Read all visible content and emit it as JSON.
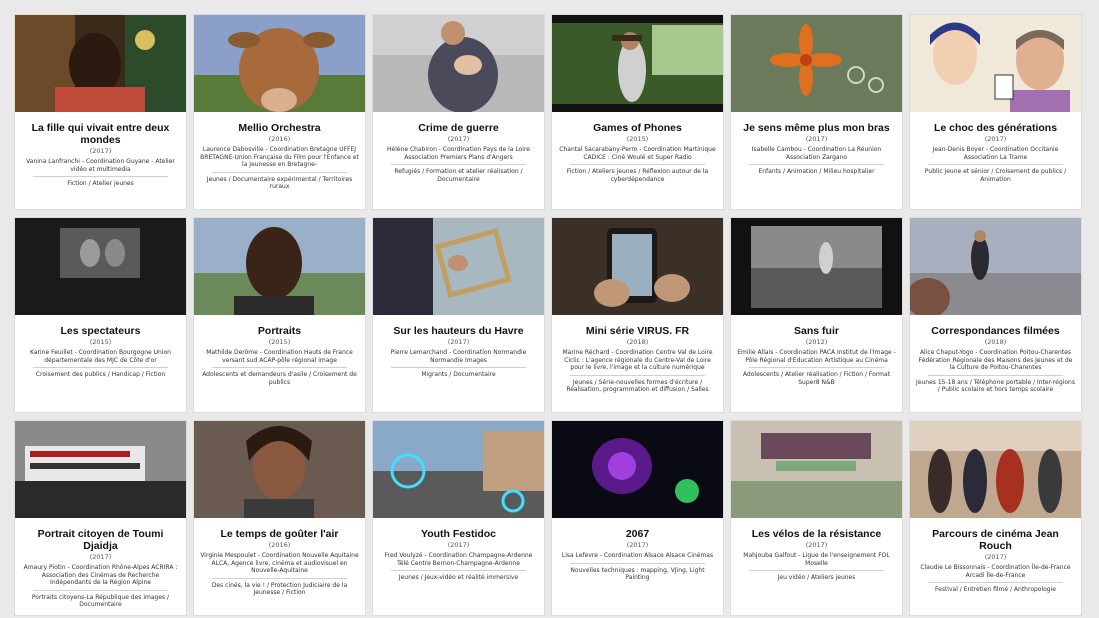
{
  "cards": [
    {
      "title": "La fille qui vivait entre deux mondes",
      "year": "(2017)",
      "credits": "Vanina Lanfranchi - Coordination Guyane - Atelier vidéo et multimedia",
      "tags": "Fiction / Atelier jeunes",
      "image": "film-still-portrait-girl"
    },
    {
      "title": "Mellio Orchestra",
      "year": "(2016)",
      "credits": "Laurence Dabosville - Coordination Bretagne UFFEJ BRETAGNE-Union Française du Film pour l'Enfance et la Jeunesse en Bretagne-",
      "tags": "Jeunes / Documentaire expérimental / Territoires ruraux",
      "image": "film-still-cow"
    },
    {
      "title": "Crime de guerre",
      "year": "(2017)",
      "credits": "Hélène Chabiron - Coordination Pays de la Loire Association Premiers Plans d'Angers",
      "tags": "Refugiés / Formation et atelier réalisation / Documentaire",
      "image": "film-still-man-holding-baby"
    },
    {
      "title": "Games of Phones",
      "year": "(2015)",
      "credits": "Chantal Sacarabany-Perro - Coordination Martinique CADICE : Ciné Woulé et Super Radio",
      "tags": "Fiction / Ateliers jeunes / Réflexion autour de la cyberdépendance",
      "image": "film-still-girl-in-garden"
    },
    {
      "title": "Je sens même plus mon bras",
      "year": "(2017)",
      "credits": "Isabelle Cambou - Coordination La Réunion Association Zargano",
      "tags": "Enfants / Animation / Milieu hospitalier",
      "image": "animation-orange-flower"
    },
    {
      "title": "Le choc des générations",
      "year": "(2017)",
      "credits": "Jean-Denis Boyer - Coordination Occitanie Association La Trame",
      "tags": "Public jeune et sénior / Croisement de publics / Animation",
      "image": "animation-two-faces"
    },
    {
      "title": "Les spectateurs",
      "year": "(2015)",
      "credits": "Karine Feuillet - Coordination Bourgogne Union départementale des MJC de Côte d'or",
      "tags": "Croisement des publics / Handicap / Fiction",
      "image": "film-still-dark-cinema-screen"
    },
    {
      "title": "Portraits",
      "year": "(2015)",
      "credits": "Mathilde Derôme - Coordination Hauts de France versant sud ACAP-pôle régional image",
      "tags": "Adolescents et demandeurs d'asile / Croisement de publics",
      "image": "film-still-man-portrait"
    },
    {
      "title": "Sur les hauteurs du Havre",
      "year": "(2017)",
      "credits": "Pierre Lemarchand - Coordination Normandie Normandie Images",
      "tags": "Migrants / Documentaire",
      "image": "film-still-hand-on-frame"
    },
    {
      "title": "Mini série VIRUS. FR",
      "year": "(2018)",
      "credits": "Marine Réchard - Coordination Centre Val de Loire Ciclic : L'agence régionale du Centre-Val de Loire pour le livre, l'image et la culture numérique",
      "tags": "Jeunes / Série-nouvelles formes d'écriture / Réalisation, programmation et diffusion / Salles",
      "image": "film-still-hands-phone"
    },
    {
      "title": "Sans fuir",
      "year": "(2012)",
      "credits": "Emilie Allais - Coordination PACA Institut de l'Image - Pôle Régional d'Education Artistique au Cinéma",
      "tags": "Adolescents / Atelier réalisation / Fiction / Format Super8 N&B",
      "image": "film-still-black-white-beach"
    },
    {
      "title": "Correspondances filmées",
      "year": "(2018)",
      "credits": "Alice Chaput-Yogo - Coordination Poitou-Charentes Fédération Régionale des Maisons des Jeunes et de la Culture de Poitou-Charentes",
      "tags": "Jeunes 15-18 ans / Téléphone portable / Inter-régions / Public scolaire et hors temps scolaire",
      "image": "film-still-man-on-beach"
    },
    {
      "title": "Portrait citoyen de Toumi Djaidja",
      "year": "(2017)",
      "credits": "Amaury Piotin - Coordination Rhône-Alpes ACRIRA : Association des Cinémas de Recherche Indépendants de la Région Alpine",
      "tags": "Portraits citoyens-La République des images / Documentaire",
      "image": "film-still-protest-march"
    },
    {
      "title": "Le temps de goûter l'air",
      "year": "(2016)",
      "credits": "Virginie Mespoulet - Coordination Nouvelle Aquitaine ALCA, Agence livre, cinéma et audiovisuel en Nouvelle-Aquitaine",
      "tags": "Des cinés, la vie ! / Protection Judiciaire de la Jeunesse / Fiction",
      "image": "film-still-young-woman"
    },
    {
      "title": "Youth Festidoc",
      "year": "(2017)",
      "credits": "Fred Voulyzé - Coordination Champagne-Ardenne Télé Centre Bernon-Champagne-Ardenne",
      "tags": "Jeunes / Jeux-vidéo et réalité immersive",
      "image": "film-still-street-hud"
    },
    {
      "title": "2067",
      "year": "(2017)",
      "credits": "Lisa Lefevre - Coordination Alsace Alsace Cinémas",
      "tags": "Nouvelles techniques : mapping, VJing, Light Painting",
      "image": "film-still-purple-light"
    },
    {
      "title": "Les vélos de la résistance",
      "year": "(2017)",
      "credits": "Mahjouba Galfout - Ligue de l'enseignement FOL Moselle",
      "tags": "Jeu vidéo / Ateliers jeunes",
      "image": "film-still-velodrome"
    },
    {
      "title": "Parcours de cinéma Jean Rouch",
      "year": "(2017)",
      "credits": "Claudie Le Bissonnais - Coordination Île-de-France Arcadi Île-de-France",
      "tags": "Festival / Entretien filmé / Anthropologie",
      "image": "film-still-group-of-youth"
    }
  ]
}
